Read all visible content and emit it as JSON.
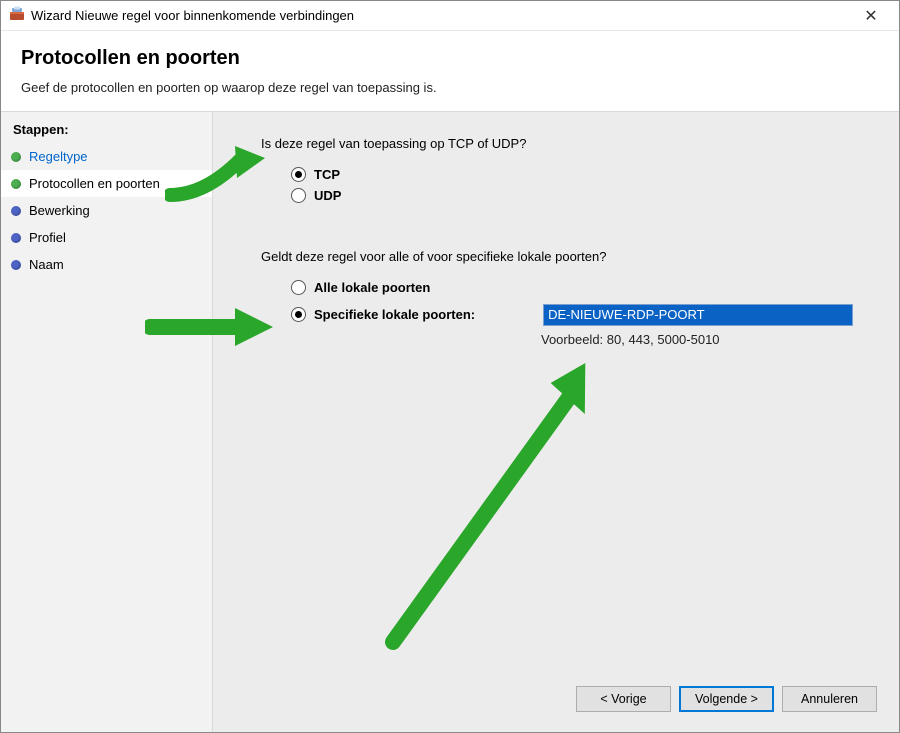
{
  "window": {
    "title": "Wizard Nieuwe regel voor binnenkomende verbindingen"
  },
  "header": {
    "title": "Protocollen en poorten",
    "subtitle": "Geef de protocollen en poorten op waarop deze regel van toepassing is."
  },
  "sidebar": {
    "steps_label": "Stappen:",
    "items": [
      {
        "label": "Regeltype"
      },
      {
        "label": "Protocollen en poorten"
      },
      {
        "label": "Bewerking"
      },
      {
        "label": "Profiel"
      },
      {
        "label": "Naam"
      }
    ]
  },
  "main": {
    "protocol_question": "Is deze regel van toepassing op TCP of UDP?",
    "tcp_label": "TCP",
    "udp_label": "UDP",
    "port_question": "Geldt deze regel voor alle of voor specifieke lokale poorten?",
    "all_ports_label": "Alle lokale poorten",
    "specific_ports_label": "Specifieke lokale poorten:",
    "port_value": "DE-NIEUWE-RDP-POORT",
    "port_hint": "Voorbeeld: 80, 443, 5000-5010"
  },
  "buttons": {
    "back": "< Vorige",
    "next": "Volgende >",
    "cancel": "Annuleren"
  }
}
